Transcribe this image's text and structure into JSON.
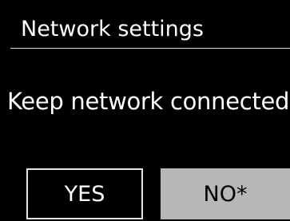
{
  "header": {
    "title": "Network settings"
  },
  "dialog": {
    "question": "Keep network connected?"
  },
  "buttons": {
    "yes_label": "YES",
    "no_label": "NO*",
    "selected": "no"
  },
  "colors": {
    "background": "#000000",
    "text": "#ffffff",
    "selected_button_bg": "#b7b7b7",
    "selected_button_text": "#000000",
    "divider": "#d8d8d8"
  }
}
